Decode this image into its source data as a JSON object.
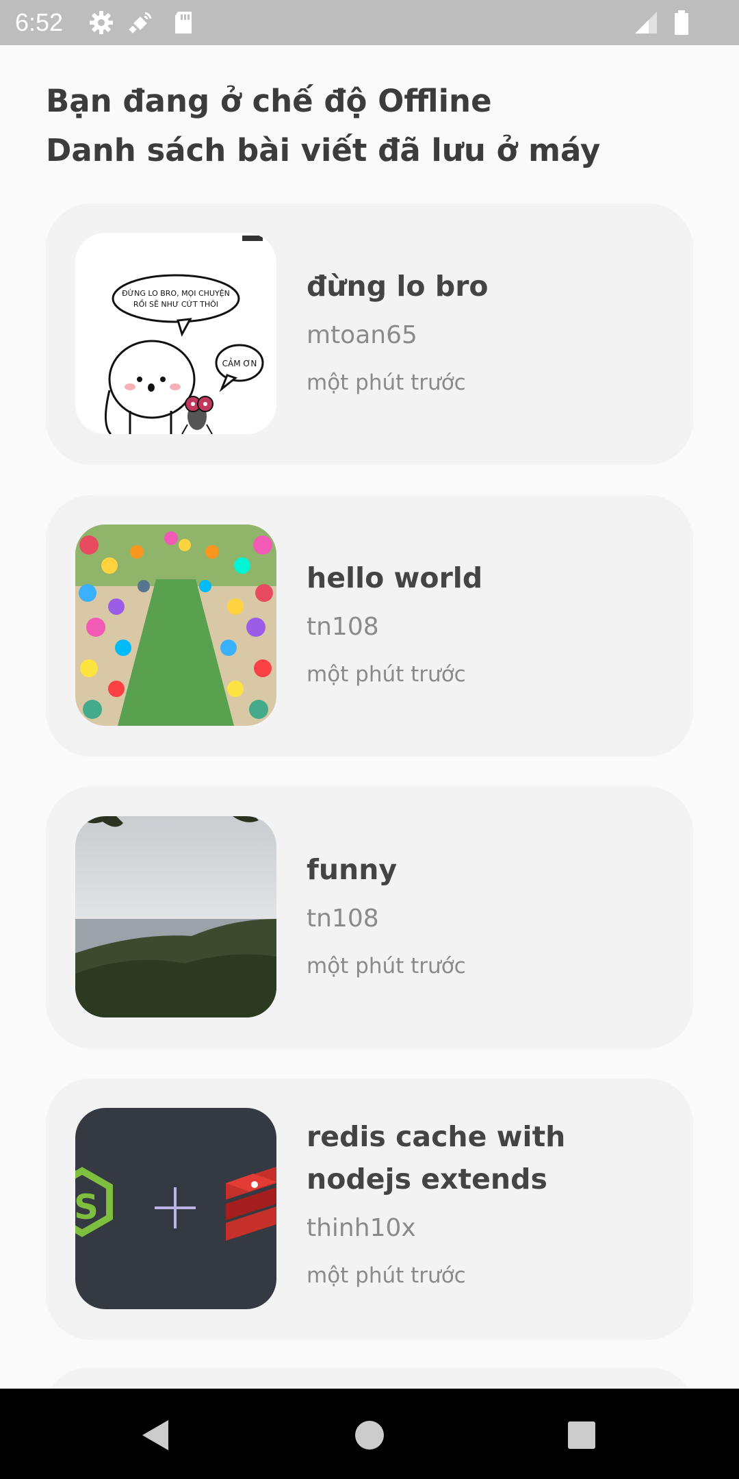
{
  "status_bar": {
    "time": "6:52",
    "icons_left": [
      "gear-icon",
      "satellite-icon",
      "sd-card-icon"
    ],
    "icons_right": [
      "signal-icon",
      "battery-icon"
    ]
  },
  "header": {
    "line1": "Bạn đang ở chế độ Offline",
    "line2": "Danh sách bài viết đã lưu ở máy"
  },
  "posts": [
    {
      "title": "đừng lo bro",
      "author": "mtoan65",
      "time": "một phút trước",
      "thumb_speech1": "ĐỪNG LO BRO, MỌI CHUYỆN RỒI SẼ NHƯ CỨT THÔI",
      "thumb_speech2": "CẢM ƠN"
    },
    {
      "title": "hello world",
      "author": "tn108",
      "time": "một phút trước"
    },
    {
      "title": "funny",
      "author": "tn108",
      "time": "một phút trước"
    },
    {
      "title": "redis cache with nodejs extends",
      "author": "thinh10x",
      "time": "một phút trước"
    }
  ],
  "nav_bar": {
    "buttons": [
      "back-icon",
      "home-icon",
      "recents-icon"
    ]
  },
  "colors": {
    "status_bar": "#bdbdbd",
    "background": "#fafafa",
    "card": "#f3f3f3",
    "title_text": "#444444",
    "meta_text": "#8a8a8a",
    "nav_bar": "#000000"
  }
}
